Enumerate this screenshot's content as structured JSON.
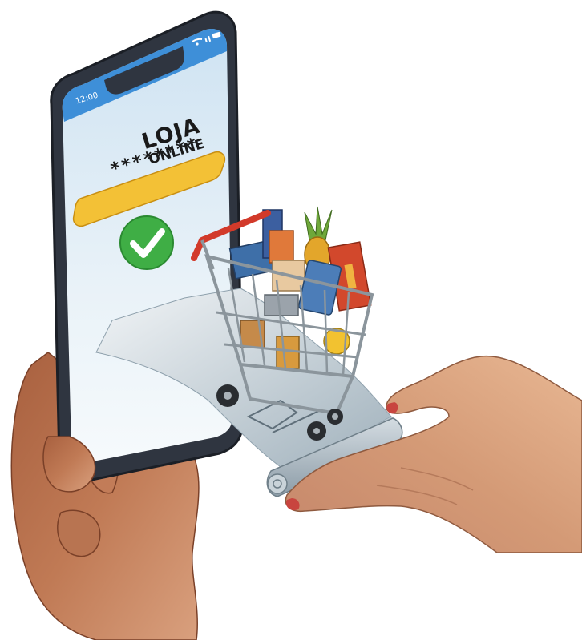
{
  "phone": {
    "status_time": "12:00",
    "store_title_line1": "LOJA",
    "store_title_line2": "ONLINE",
    "password_masked": "********"
  },
  "colors": {
    "phone_body": "#2f3540",
    "screen_top": "#cfe3f2",
    "status_bar": "#3e8fd8",
    "password_field": "#f3c136",
    "check_green": "#3fae45",
    "cart_handle": "#d23a2a",
    "skin": "#b9714f",
    "nail": "#c8453f",
    "receipt": "#a9b8c2"
  },
  "icons": [
    "check-icon",
    "wifi-icon",
    "signal-icon",
    "battery-icon",
    "shopping-cart-icon"
  ]
}
